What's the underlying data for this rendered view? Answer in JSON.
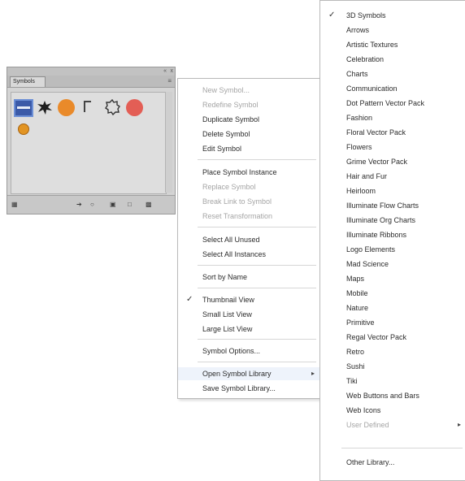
{
  "panel": {
    "tab_label": "Symbols",
    "collapse_glyph": "«",
    "close_glyph": "x",
    "menu_glyph": "≡",
    "bottom_icons": [
      "library-menu-icon",
      "place-instance-icon",
      "break-link-icon",
      "symbol-options-icon",
      "new-symbol-icon",
      "delete-icon"
    ]
  },
  "main_menu": {
    "items": [
      {
        "label": "New Symbol...",
        "disabled": true
      },
      {
        "label": "Redefine Symbol",
        "disabled": true
      },
      {
        "label": "Duplicate Symbol",
        "disabled": false
      },
      {
        "label": "Delete Symbol",
        "disabled": false
      },
      {
        "label": "Edit Symbol",
        "disabled": false
      },
      {
        "label": "Place Symbol Instance",
        "disabled": false
      },
      {
        "label": "Replace Symbol",
        "disabled": true
      },
      {
        "label": "Break Link to Symbol",
        "disabled": true
      },
      {
        "label": "Reset Transformation",
        "disabled": true
      },
      {
        "label": "Select All Unused",
        "disabled": false
      },
      {
        "label": "Select All Instances",
        "disabled": false
      },
      {
        "label": "Sort by Name",
        "disabled": false
      },
      {
        "label": "Thumbnail View",
        "disabled": false,
        "checked": true
      },
      {
        "label": "Small List View",
        "disabled": false
      },
      {
        "label": "Large List View",
        "disabled": false
      },
      {
        "label": "Symbol Options...",
        "disabled": false
      },
      {
        "label": "Open Symbol Library",
        "disabled": false,
        "submenu": true
      },
      {
        "label": "Save Symbol Library...",
        "disabled": false
      }
    ]
  },
  "library_menu": {
    "items": [
      {
        "label": "3D Symbols",
        "checked": true
      },
      {
        "label": "Arrows"
      },
      {
        "label": "Artistic Textures"
      },
      {
        "label": "Celebration"
      },
      {
        "label": "Charts"
      },
      {
        "label": "Communication"
      },
      {
        "label": "Dot Pattern Vector Pack"
      },
      {
        "label": "Fashion"
      },
      {
        "label": "Floral Vector Pack"
      },
      {
        "label": "Flowers"
      },
      {
        "label": "Grime Vector Pack"
      },
      {
        "label": "Hair and Fur"
      },
      {
        "label": "Heirloom"
      },
      {
        "label": "Illuminate Flow Charts"
      },
      {
        "label": "Illuminate Org Charts"
      },
      {
        "label": "Illuminate Ribbons"
      },
      {
        "label": "Logo Elements"
      },
      {
        "label": "Mad Science"
      },
      {
        "label": "Maps"
      },
      {
        "label": "Mobile"
      },
      {
        "label": "Nature"
      },
      {
        "label": "Primitive"
      },
      {
        "label": "Regal Vector Pack"
      },
      {
        "label": "Retro"
      },
      {
        "label": "Sushi"
      },
      {
        "label": "Tiki"
      },
      {
        "label": "Web Buttons and Bars"
      },
      {
        "label": "Web Icons"
      },
      {
        "label": "User Defined",
        "disabled": true,
        "submenu": true
      },
      {
        "label": "Other Library..."
      }
    ]
  }
}
